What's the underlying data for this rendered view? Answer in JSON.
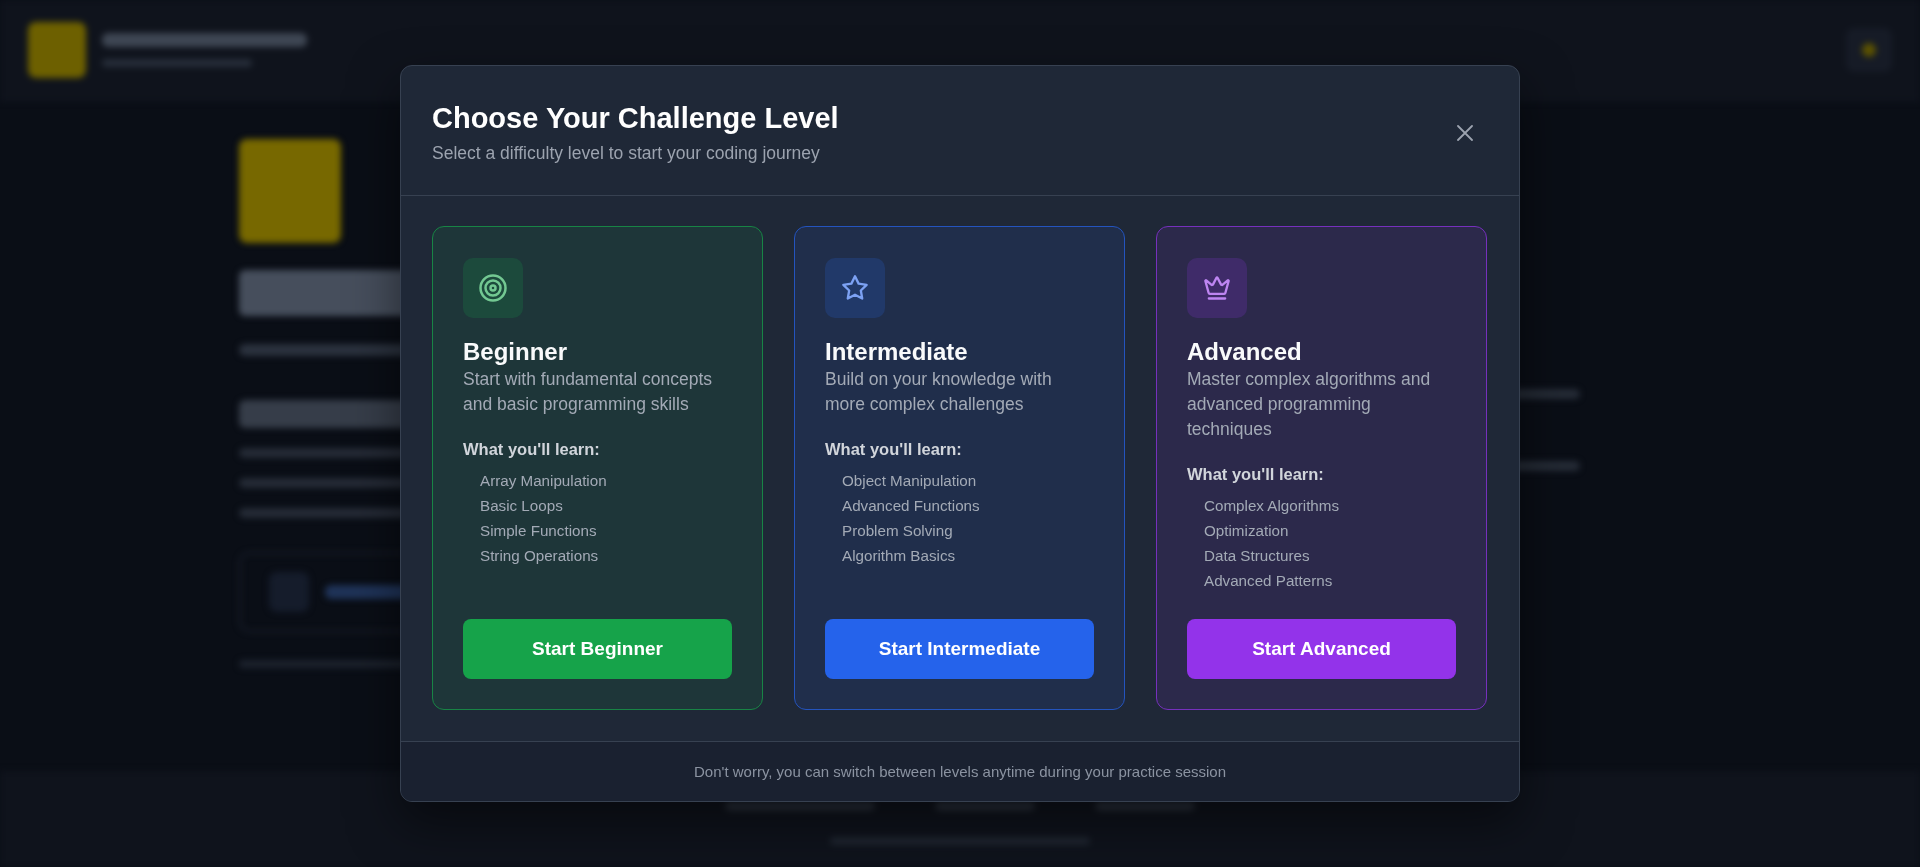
{
  "dialog": {
    "title": "Choose Your Challenge Level",
    "subtitle": "Select a difficulty level to start your coding journey",
    "footer_note": "Don't worry, you can switch between levels anytime during your practice session"
  },
  "levels": [
    {
      "kind": "beginner",
      "name": "Beginner",
      "description": "Start with fundamental concepts and basic programming skills",
      "learn_heading": "What you'll learn:",
      "topics": [
        "Array Manipulation",
        "Basic Loops",
        "Simple Functions",
        "String Operations"
      ],
      "button": "Start Beginner",
      "color": "#16a34a"
    },
    {
      "kind": "intermediate",
      "name": "Intermediate",
      "description": "Build on your knowledge with more complex challenges",
      "learn_heading": "What you'll learn:",
      "topics": [
        "Object Manipulation",
        "Advanced Functions",
        "Problem Solving",
        "Algorithm Basics"
      ],
      "button": "Start Intermediate",
      "color": "#2563eb"
    },
    {
      "kind": "advanced",
      "name": "Advanced",
      "description": "Master complex algorithms and advanced programming techniques",
      "learn_heading": "What you'll learn:",
      "topics": [
        "Complex Algorithms",
        "Optimization",
        "Data Structures",
        "Advanced Patterns"
      ],
      "button": "Start Advanced",
      "color": "#9333ea"
    }
  ]
}
